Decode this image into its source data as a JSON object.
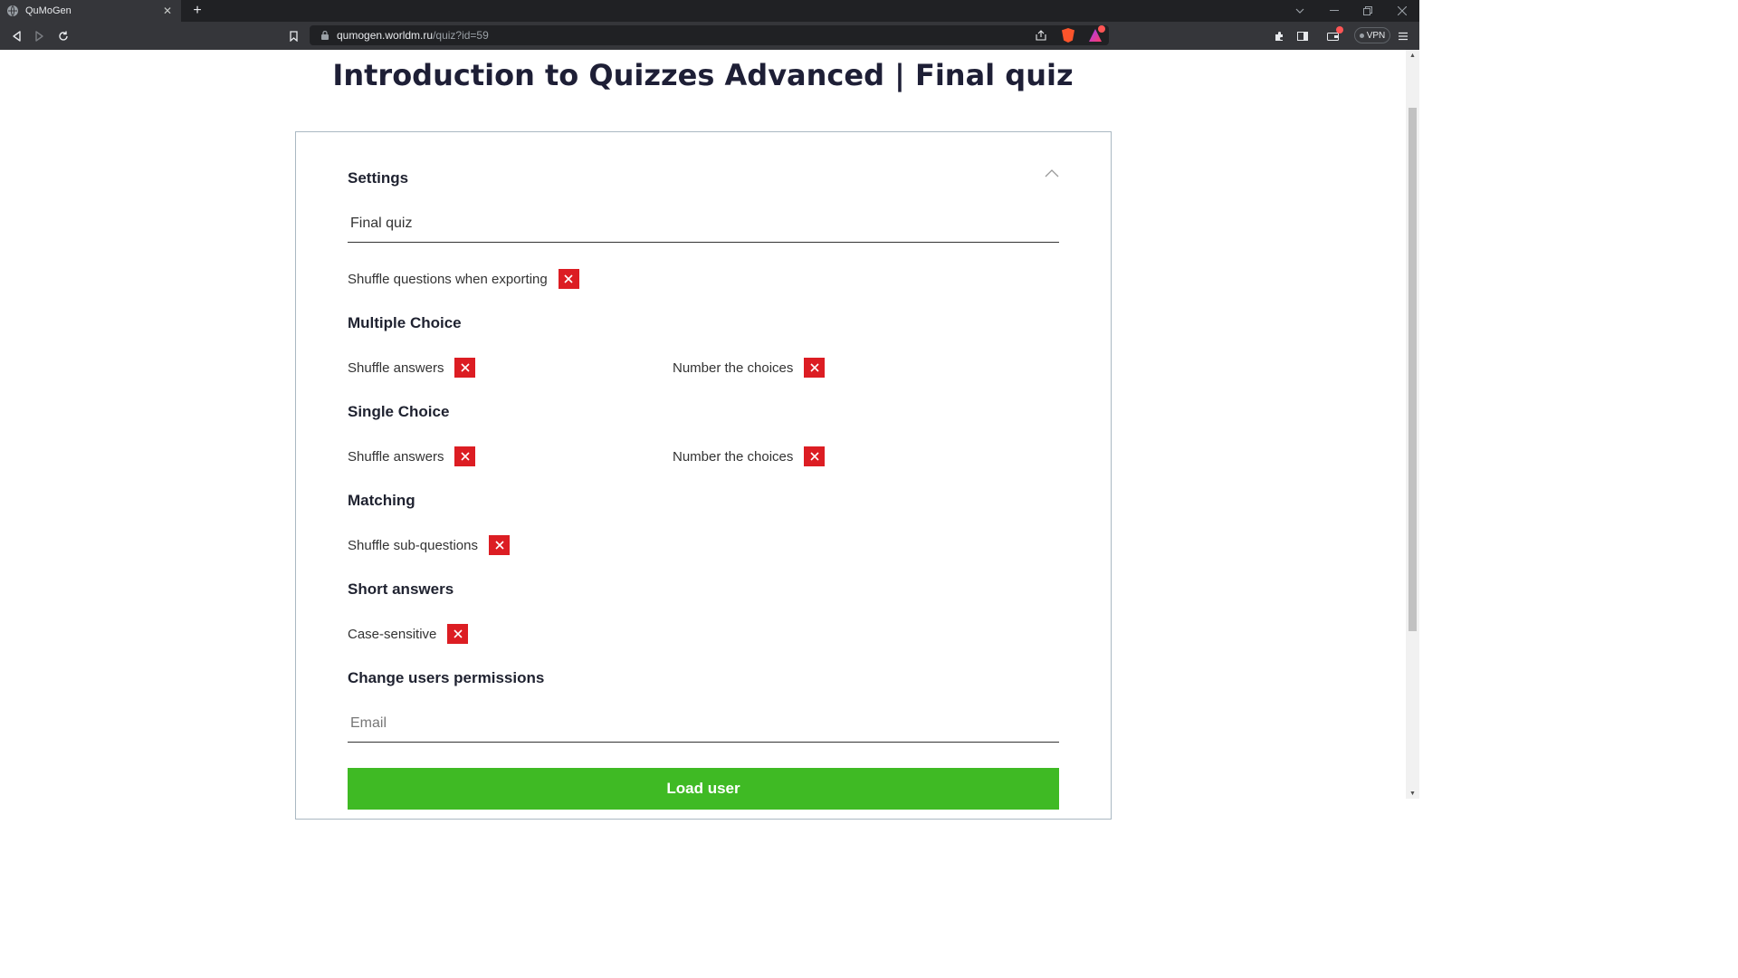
{
  "browser": {
    "tab_title": "QuMoGen",
    "url_host": "qumogen.worldm.ru",
    "url_path": "/quiz?id=59",
    "vpn_label": "VPN",
    "new_tab_symbol": "+",
    "tab_close_symbol": "✕"
  },
  "page": {
    "title": "Introduction to Quizzes Advanced | Final quiz"
  },
  "settings": {
    "heading": "Settings",
    "quiz_name_value": "Final quiz",
    "shuffle_questions_label": "Shuffle questions when exporting",
    "multiple_choice": {
      "heading": "Multiple Choice",
      "shuffle_answers_label": "Shuffle answers",
      "number_choices_label": "Number the choices"
    },
    "single_choice": {
      "heading": "Single Choice",
      "shuffle_answers_label": "Shuffle answers",
      "number_choices_label": "Number the choices"
    },
    "matching": {
      "heading": "Matching",
      "shuffle_subquestions_label": "Shuffle sub-questions"
    },
    "short_answers": {
      "heading": "Short answers",
      "case_sensitive_label": "Case-sensitive"
    },
    "permissions": {
      "heading": "Change users permissions",
      "email_placeholder": "Email",
      "load_button_label": "Load user"
    }
  },
  "colors": {
    "toggle_off": "#dc1d23",
    "button_green": "#3fba24",
    "chrome_dark": "#35363a"
  }
}
